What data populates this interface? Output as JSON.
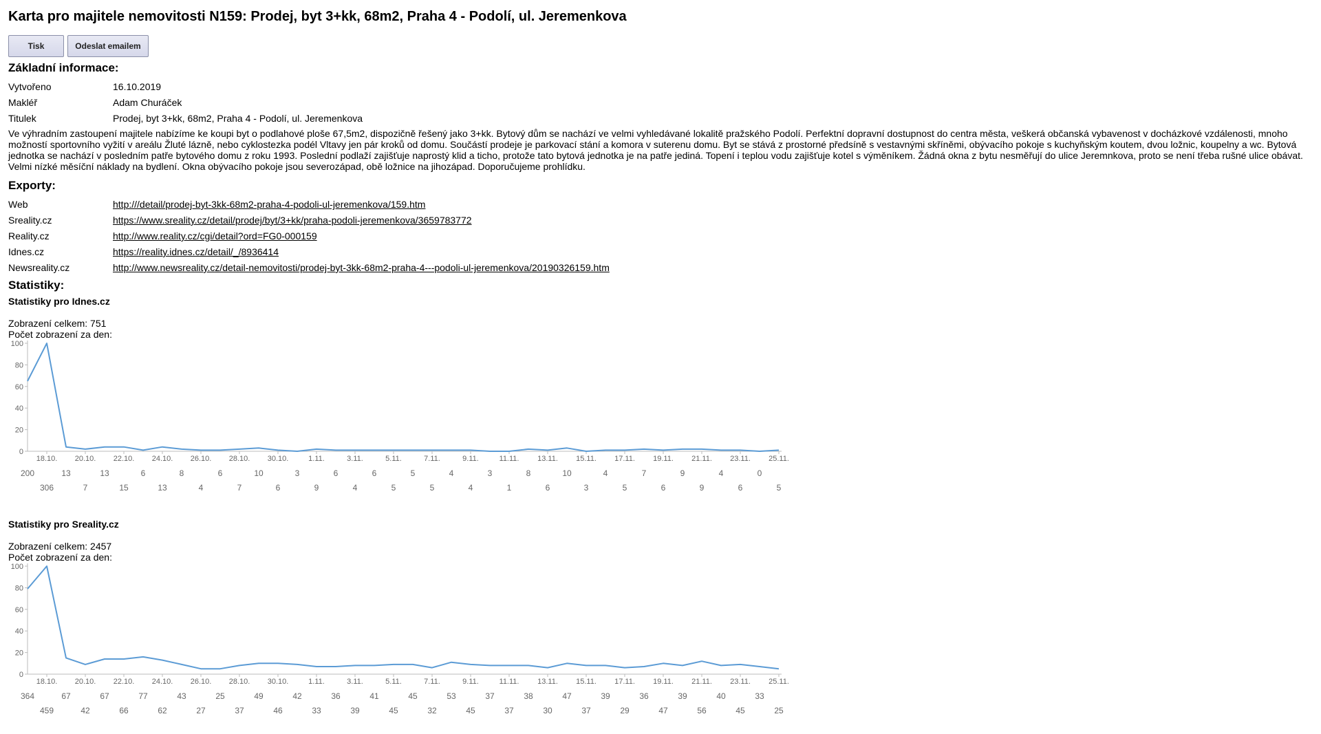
{
  "title": "Karta pro majitele nemovitosti N159: Prodej, byt 3+kk, 68m2, Praha 4 - Podolí, ul. Jeremenkova",
  "buttons": {
    "print": "Tisk",
    "email": "Odeslat emailem"
  },
  "basic": {
    "heading": "Základní informace:",
    "rows": [
      {
        "label": "Vytvořeno",
        "value": "16.10.2019"
      },
      {
        "label": "Makléř",
        "value": "Adam Churáček"
      },
      {
        "label": "Titulek",
        "value": "Prodej, byt 3+kk, 68m2, Praha 4 - Podolí, ul. Jeremenkova"
      }
    ],
    "description": "Ve výhradním zastoupení majitele nabízíme ke koupi byt o podlahové ploše 67,5m2, dispozičně řešený jako 3+kk. Bytový dům se nachází ve velmi vyhledávané lokalitě pražského Podolí. Perfektní dopravní dostupnost do centra města, veškerá občanská vybavenost v docházkové vzdálenosti, mnoho možností sportovního vyžití v areálu Žluté lázně, nebo cyklostezka podél Vltavy jen pár kroků od domu. Součástí prodeje je parkovací stání a komora v suterenu domu. Byt se stává z prostorné předsíně s vestavnými skříněmi, obývacího pokoje s kuchyňským koutem, dvou ložnic, koupelny a wc. Bytová jednotka se nachází v posledním patře bytového domu z roku 1993. Poslední podlaží zajišťuje naprostý klid a ticho, protože tato bytová jednotka je na patře jediná. Topení i teplou vodu zajišťuje kotel s výměníkem. Žádná okna z bytu nesměřují do ulice Jeremnkova, proto se není třeba rušné ulice obávat. Velmi nízké měsíční náklady na bydlení. Okna obývacího pokoje jsou severozápad, obě ložnice na jihozápad. Doporučujeme prohlídku."
  },
  "exports": {
    "heading": "Exporty:",
    "rows": [
      {
        "label": "Web",
        "url": "http:///detail/prodej-byt-3kk-68m2-praha-4-podoli-ul-jeremenkova/159.htm"
      },
      {
        "label": "Sreality.cz",
        "url": "https://www.sreality.cz/detail/prodej/byt/3+kk/praha-podoli-jeremenkova/3659783772"
      },
      {
        "label": "Reality.cz",
        "url": "http://www.reality.cz/cgi/detail?ord=FG0-000159"
      },
      {
        "label": "Idnes.cz",
        "url": "https://reality.idnes.cz/detail/_/8936414"
      },
      {
        "label": "Newsreality.cz",
        "url": "http://www.newsreality.cz/detail-nemovitosti/prodej-byt-3kk-68m2-praha-4---podoli-ul-jeremenkova/20190326159.htm"
      }
    ]
  },
  "stats": {
    "heading": "Statistiky:",
    "idnes": {
      "heading": "Statistiky pro Idnes.cz",
      "total": "Zobrazení celkem: 751",
      "perday": "Počet zobrazení za den:"
    },
    "sreality": {
      "heading": "Statistiky pro Sreality.cz",
      "total": "Zobrazení celkem: 2457",
      "perday": "Počet zobrazení za den:"
    }
  },
  "chart_data": [
    {
      "type": "line",
      "title": "Statistiky pro Idnes.cz",
      "color": "#5b9bd5",
      "ylim": [
        0,
        100
      ],
      "yticks": [
        0,
        20,
        40,
        60,
        80,
        100
      ],
      "x": [
        "17.10.",
        "18.10.",
        "19.10.",
        "20.10.",
        "21.10.",
        "22.10.",
        "23.10.",
        "24.10.",
        "25.10.",
        "26.10.",
        "27.10.",
        "28.10.",
        "29.10.",
        "30.10.",
        "31.10.",
        "1.11.",
        "2.11.",
        "3.11.",
        "4.11.",
        "5.11.",
        "6.11.",
        "7.11.",
        "8.11.",
        "9.11.",
        "10.11.",
        "11.11.",
        "12.11.",
        "13.11.",
        "14.11.",
        "15.11.",
        "16.11.",
        "17.11.",
        "18.11.",
        "19.11.",
        "20.11.",
        "21.11.",
        "22.11.",
        "23.11.",
        "24.11.",
        "25.11."
      ],
      "xticklabels": [
        "18.10.",
        "20.10.",
        "22.10.",
        "24.10.",
        "26.10.",
        "28.10.",
        "30.10.",
        "1.11.",
        "3.11.",
        "5.11.",
        "7.11.",
        "9.11.",
        "11.11.",
        "13.11.",
        "15.11.",
        "17.11.",
        "19.11.",
        "21.11.",
        "23.11.",
        "25.11."
      ],
      "values": [
        65,
        100,
        4,
        2,
        4,
        4,
        1,
        4,
        2,
        1,
        1,
        2,
        3,
        1,
        0,
        2,
        1,
        1,
        1,
        1,
        1,
        1,
        1,
        1,
        0,
        0,
        2,
        1,
        3,
        0,
        1,
        1,
        2,
        1,
        2,
        2,
        1,
        1,
        0,
        1
      ],
      "counts_row1": [
        "200",
        "13",
        "13",
        "6",
        "8",
        "6",
        "10",
        "3",
        "6",
        "6",
        "5",
        "4",
        "3",
        "8",
        "10",
        "4",
        "7",
        "9",
        "4",
        "0"
      ],
      "counts_row2": [
        "306",
        "7",
        "15",
        "13",
        "4",
        "7",
        "6",
        "9",
        "4",
        "5",
        "5",
        "4",
        "1",
        "6",
        "3",
        "5",
        "6",
        "9",
        "6",
        "5"
      ]
    },
    {
      "type": "line",
      "title": "Statistiky pro Sreality.cz",
      "color": "#5b9bd5",
      "ylim": [
        0,
        100
      ],
      "yticks": [
        0,
        20,
        40,
        60,
        80,
        100
      ],
      "x": [
        "17.10.",
        "18.10.",
        "19.10.",
        "20.10.",
        "21.10.",
        "22.10.",
        "23.10.",
        "24.10.",
        "25.10.",
        "26.10.",
        "27.10.",
        "28.10.",
        "29.10.",
        "30.10.",
        "31.10.",
        "1.11.",
        "2.11.",
        "3.11.",
        "4.11.",
        "5.11.",
        "6.11.",
        "7.11.",
        "8.11.",
        "9.11.",
        "10.11.",
        "11.11.",
        "12.11.",
        "13.11.",
        "14.11.",
        "15.11.",
        "16.11.",
        "17.11.",
        "18.11.",
        "19.11.",
        "20.11.",
        "21.11.",
        "22.11.",
        "23.11.",
        "24.11.",
        "25.11."
      ],
      "xticklabels": [
        "18.10.",
        "20.10.",
        "22.10.",
        "24.10.",
        "26.10.",
        "28.10.",
        "30.10.",
        "1.11.",
        "3.11.",
        "5.11.",
        "7.11.",
        "9.11.",
        "11.11.",
        "13.11.",
        "15.11.",
        "17.11.",
        "19.11.",
        "21.11.",
        "23.11.",
        "25.11."
      ],
      "values": [
        79,
        100,
        15,
        9,
        14,
        14,
        16,
        13,
        9,
        5,
        5,
        8,
        10,
        10,
        9,
        7,
        7,
        8,
        8,
        9,
        9,
        6,
        11,
        9,
        8,
        8,
        8,
        6,
        10,
        8,
        8,
        6,
        7,
        10,
        8,
        12,
        8,
        9,
        7,
        5
      ],
      "counts_row1": [
        "364",
        "67",
        "67",
        "77",
        "43",
        "25",
        "49",
        "42",
        "36",
        "41",
        "45",
        "53",
        "37",
        "38",
        "47",
        "39",
        "36",
        "39",
        "40",
        "33"
      ],
      "counts_row2": [
        "459",
        "42",
        "66",
        "62",
        "27",
        "37",
        "46",
        "33",
        "39",
        "45",
        "32",
        "45",
        "37",
        "30",
        "37",
        "29",
        "47",
        "56",
        "45",
        "25"
      ]
    }
  ]
}
